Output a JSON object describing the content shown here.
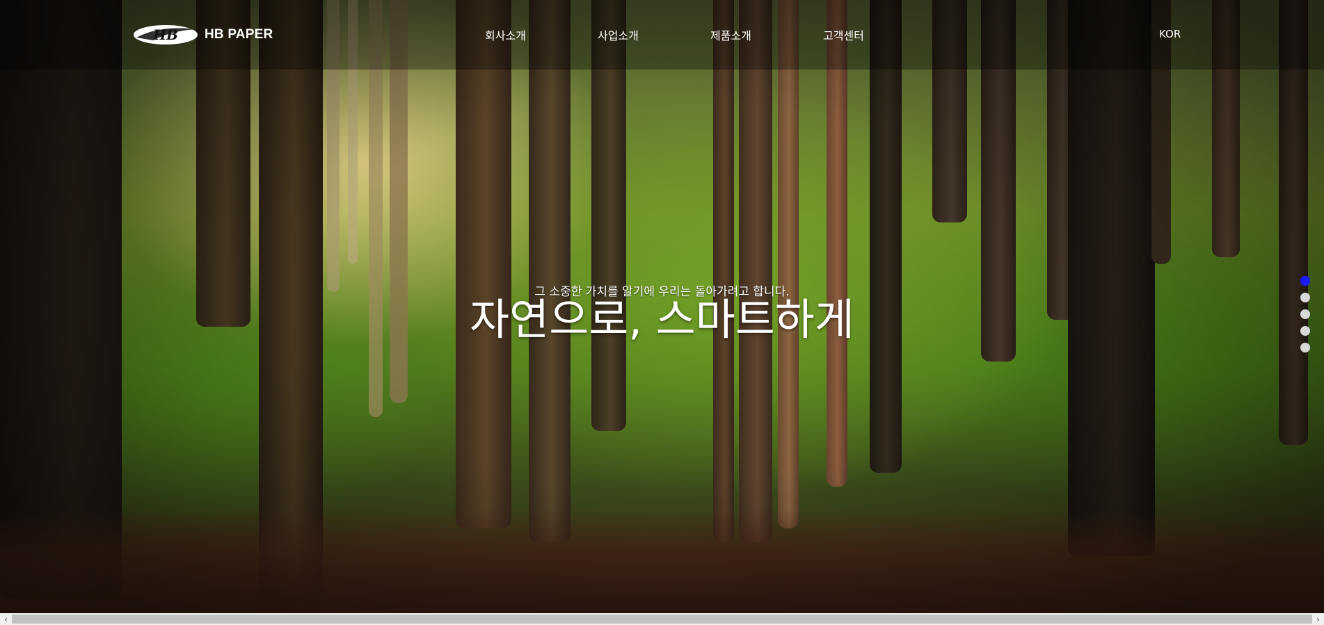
{
  "header": {
    "brand": "HB PAPER",
    "logo_mark_text": "HB",
    "nav": [
      {
        "label": "회사소개"
      },
      {
        "label": "사업소개"
      },
      {
        "label": "제품소개"
      },
      {
        "label": "고객센터"
      }
    ],
    "language": "KOR"
  },
  "hero": {
    "subtitle": "그 소중한 가치를 알기에 우리는 돌아가려고 합니다.",
    "title": "자연으로, 스마트하게"
  },
  "pagination": {
    "count": 5,
    "active_index": 0,
    "active_color": "#1a1aff",
    "inactive_color": "#d9d9d9"
  },
  "scrollbar": {
    "left_arrow": "‹",
    "right_arrow": "›"
  }
}
